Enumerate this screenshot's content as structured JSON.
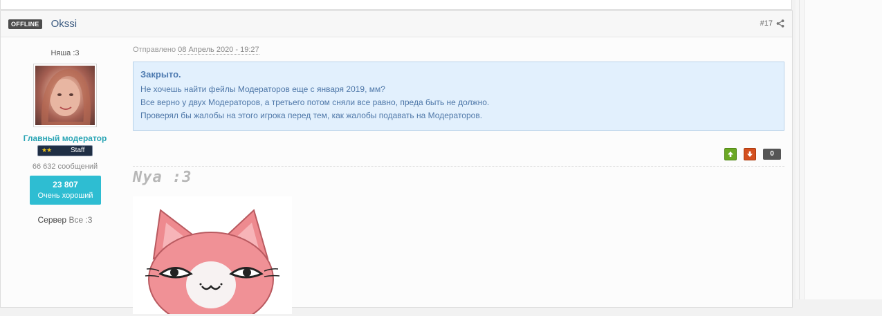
{
  "post": {
    "status": "OFFLINE",
    "author": "Okssi",
    "number": "#17",
    "author_title": "Няша :3",
    "group": "Главный модератор",
    "badge_label": "Staff",
    "post_count": "66 632 сообщений",
    "reputation_value": "23 807",
    "reputation_label": "Очень хороший",
    "server_label": "Сервер",
    "server_value": "Все :3",
    "posted_label": "Отправлено",
    "posted_date": "08 Апрель 2020 - 19:27",
    "notice": {
      "title": "Закрыто.",
      "lines": [
        "Не хочешь найти фейлы Модераторов еще с января 2019, мм?",
        "Все верно у двух Модераторов, а третьего потом сняли все равно, преда быть не должно.",
        "Проверял бы жалобы на этого игрока перед тем, как жалобы подавать на Модераторов."
      ]
    },
    "vote_up_icon": "arrow-up-icon",
    "vote_down_icon": "arrow-down-icon",
    "rep_count": "0",
    "signature_text": "Nya :3"
  },
  "colors": {
    "accent": "#2aa5b5",
    "notice_bg": "#e2f0fd",
    "vote_up": "#6ba824",
    "vote_down": "#d4501f"
  }
}
